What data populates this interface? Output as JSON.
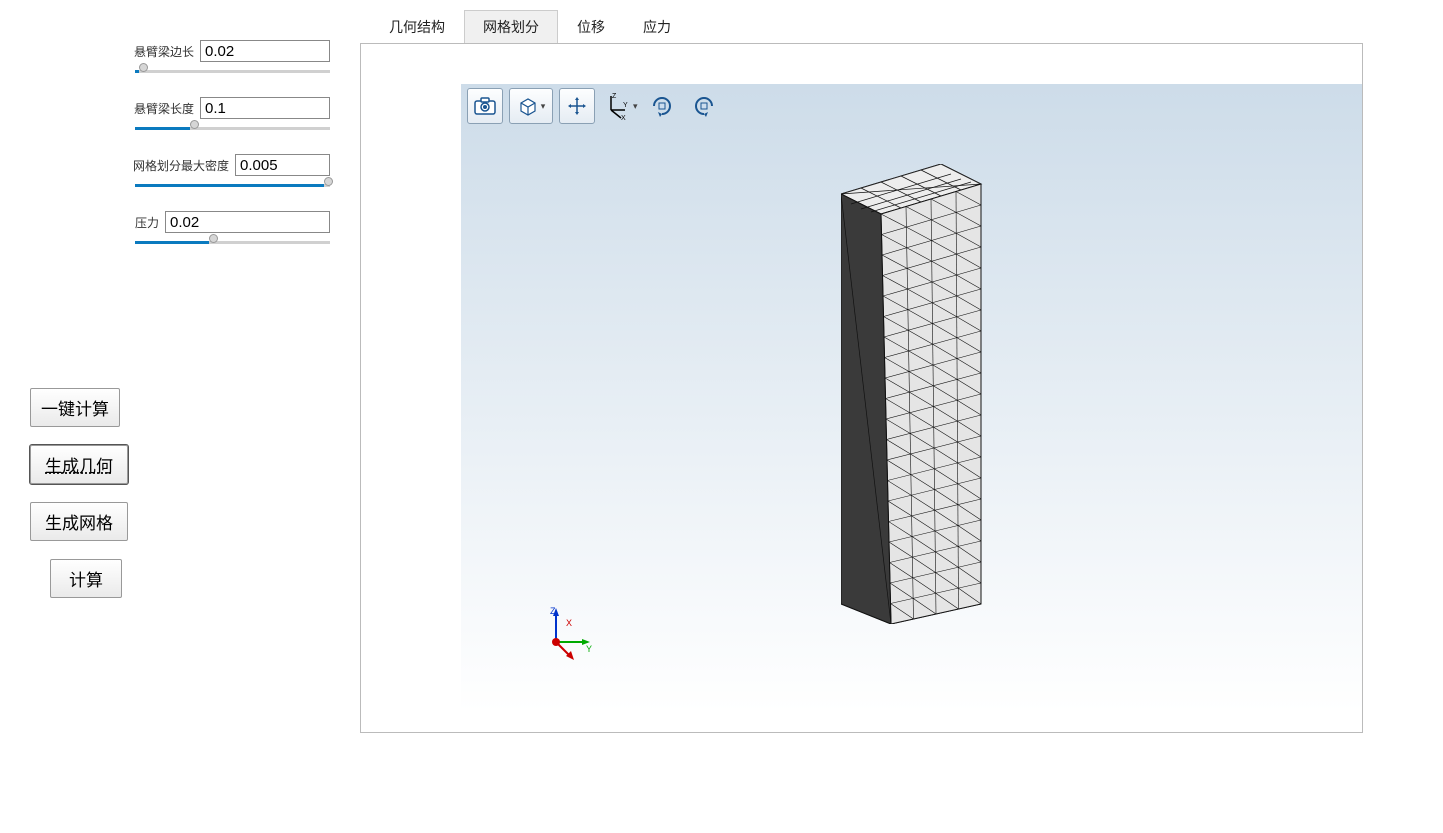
{
  "sidebar": {
    "params": [
      {
        "label": "悬臂梁边长",
        "value": "0.02",
        "sliderPct": 2
      },
      {
        "label": "悬臂梁长度",
        "value": "0.1",
        "sliderPct": 28
      },
      {
        "label": "网格划分最大密度",
        "value": "0.005",
        "sliderPct": 97
      },
      {
        "label": "压力",
        "value": "0.02",
        "sliderPct": 38
      }
    ],
    "buttons": {
      "one_click": "一键计算",
      "gen_geom": "生成几何",
      "gen_mesh": "生成网格",
      "compute": "计算"
    }
  },
  "tabs": [
    {
      "label": "几何结构",
      "active": false
    },
    {
      "label": "网格划分",
      "active": true
    },
    {
      "label": "位移",
      "active": false
    },
    {
      "label": "应力",
      "active": false
    }
  ],
  "toolbar_icons": [
    "camera",
    "cube-view",
    "pan",
    "axis-xyz",
    "rotate-cw",
    "rotate-ccw"
  ],
  "axis_labels": {
    "x": "X",
    "y": "Y",
    "z": "Z"
  }
}
